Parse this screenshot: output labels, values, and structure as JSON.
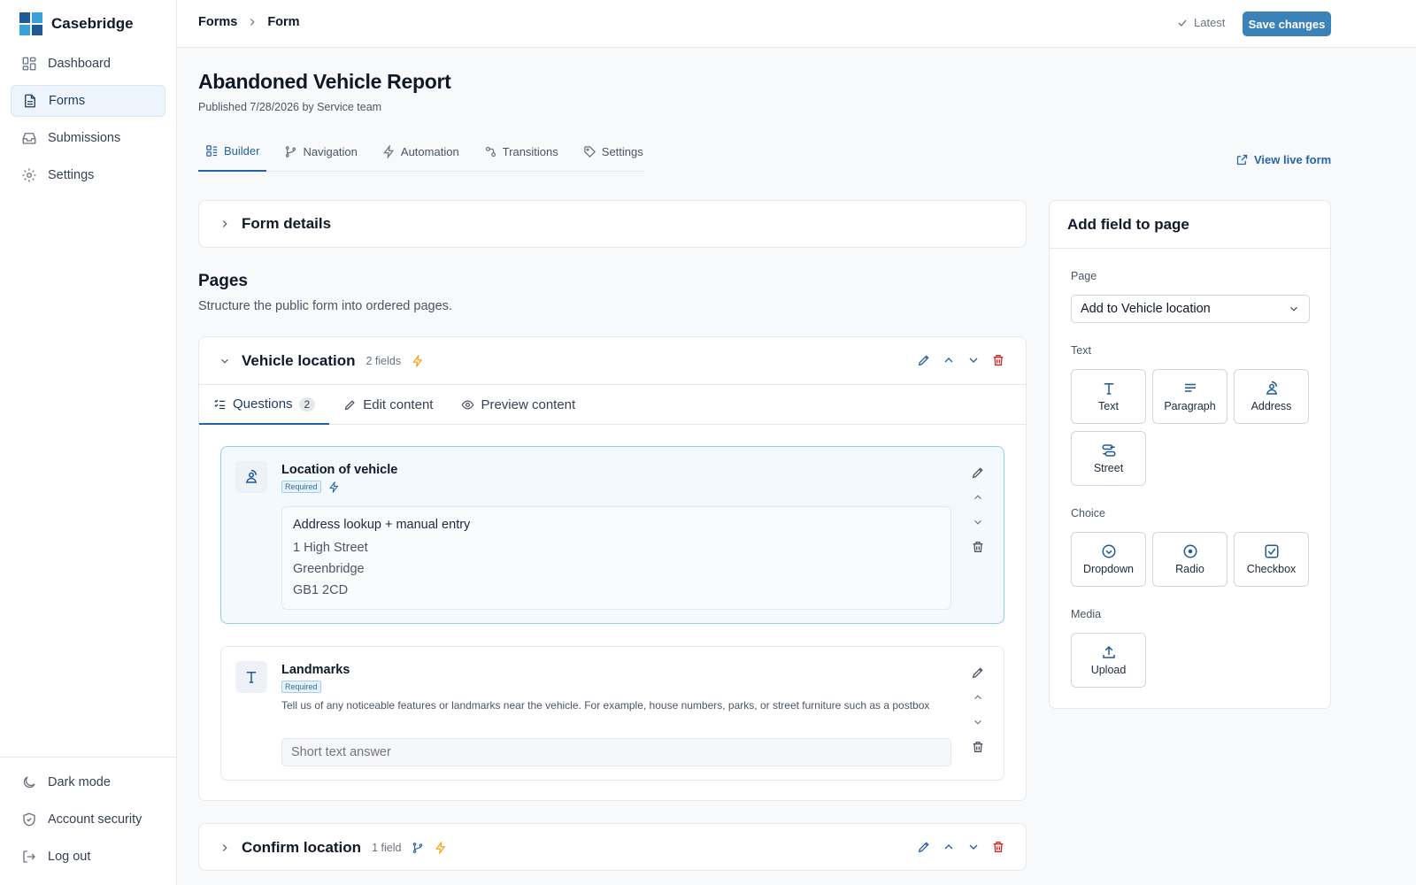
{
  "sidebar": {
    "brand": "Casebridge",
    "items": [
      {
        "label": "Dashboard",
        "icon": "dashboard-icon"
      },
      {
        "label": "Forms",
        "icon": "document-icon",
        "active": true
      },
      {
        "label": "Submissions",
        "icon": "inbox-icon"
      },
      {
        "label": "Settings",
        "icon": "gear-icon"
      }
    ],
    "bottom": [
      {
        "label": "Dark mode",
        "icon": "moon-icon"
      },
      {
        "label": "Account security",
        "icon": "shield-icon"
      },
      {
        "label": "Log out",
        "icon": "logout-icon"
      }
    ]
  },
  "topbar": {
    "breadcrumb": [
      "Forms",
      "Form"
    ],
    "latest": "Latest",
    "save_label": "Save changes"
  },
  "header": {
    "title": "Abandoned Vehicle Report",
    "published": "Published 7/28/2026 by Service team",
    "tabs": [
      {
        "label": "Builder",
        "icon": "builder-icon",
        "active": true
      },
      {
        "label": "Navigation",
        "icon": "branch-icon"
      },
      {
        "label": "Automation",
        "icon": "lightning-icon"
      },
      {
        "label": "Transitions",
        "icon": "transitions-icon"
      },
      {
        "label": "Settings",
        "icon": "tag-icon"
      }
    ],
    "live_link": "View live form"
  },
  "form_details": {
    "label": "Form details"
  },
  "pages_section": {
    "title": "Pages",
    "subtitle": "Structure the public form into ordered pages."
  },
  "pages": [
    {
      "title": "Vehicle location",
      "count": "2 fields",
      "sub_tabs": [
        {
          "label": "Questions",
          "count": "2",
          "active": true
        },
        {
          "label": "Edit content"
        },
        {
          "label": "Preview content"
        }
      ],
      "questions": [
        {
          "title": "Location of vehicle",
          "badge": "Required",
          "icon": "address-icon",
          "address": {
            "heading": "Address lookup + manual entry",
            "lines": [
              "1 High Street",
              "Greenbridge",
              "GB1 2CD"
            ]
          }
        },
        {
          "title": "Landmarks",
          "badge": "Required",
          "icon": "text-icon",
          "help": "Tell us of any noticeable features or landmarks near the vehicle. For example, house numbers, parks, or street furniture such as a postbox",
          "placeholder": "Short text answer"
        }
      ]
    },
    {
      "title": "Confirm location",
      "count": "1 field"
    }
  ],
  "add_field": {
    "title": "Add field to page",
    "page_label": "Page",
    "page_value": "Add to Vehicle location",
    "groups": [
      {
        "label": "Text",
        "fields": [
          {
            "label": "Text",
            "icon": "text-icon"
          },
          {
            "label": "Paragraph",
            "icon": "paragraph-icon"
          },
          {
            "label": "Address",
            "icon": "address-icon"
          },
          {
            "label": "Street",
            "icon": "street-icon"
          }
        ]
      },
      {
        "label": "Choice",
        "fields": [
          {
            "label": "Dropdown",
            "icon": "dropdown-icon"
          },
          {
            "label": "Radio",
            "icon": "radio-icon"
          },
          {
            "label": "Checkbox",
            "icon": "checkbox-icon"
          }
        ]
      },
      {
        "label": "Media",
        "fields": [
          {
            "label": "Upload",
            "icon": "upload-icon"
          }
        ]
      }
    ]
  },
  "colors": {
    "accent": "#2563a8",
    "save_button": "#3b82b8",
    "danger": "#dc2626",
    "lightning": "#f59e0b"
  }
}
